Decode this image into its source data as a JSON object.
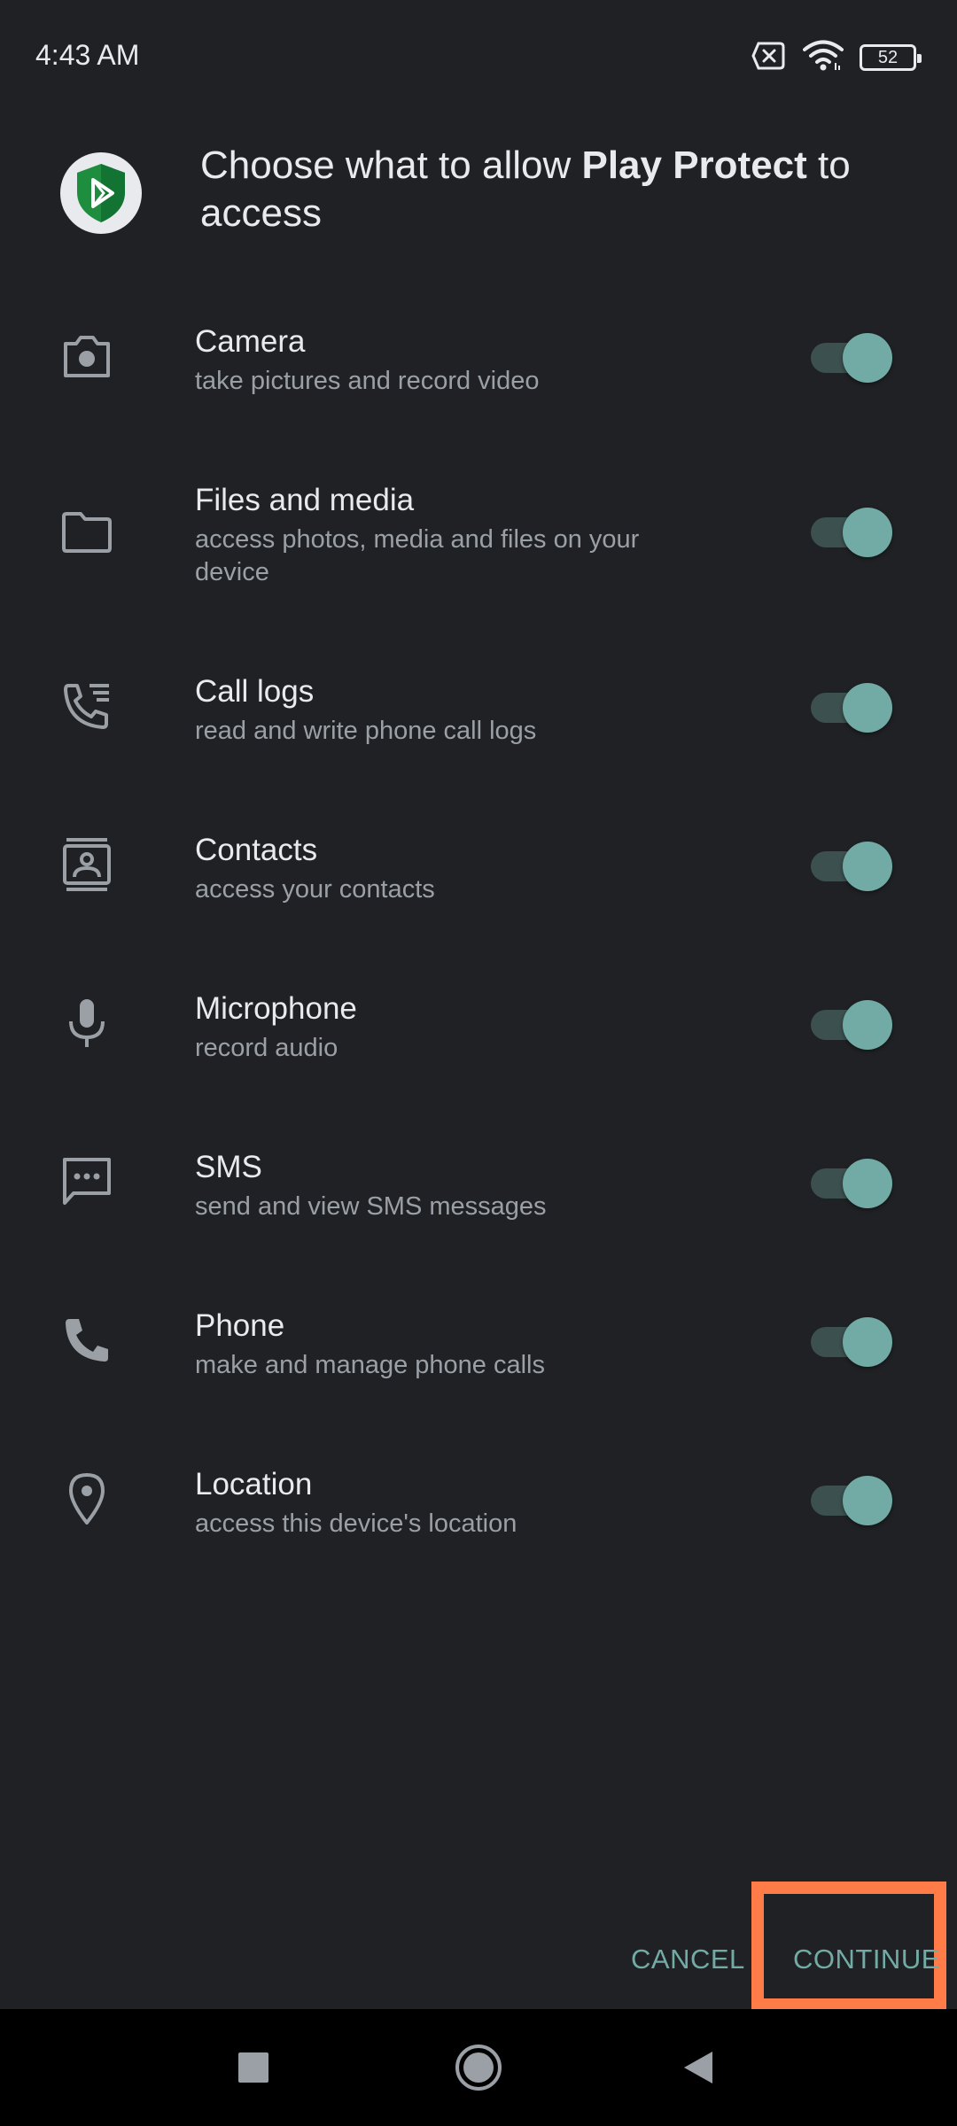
{
  "status_bar": {
    "time": "4:43 AM",
    "battery": "52",
    "icons": [
      "no-sim-icon",
      "wifi-icon",
      "battery-icon"
    ]
  },
  "header": {
    "title_prefix": "Choose what to allow ",
    "app_name": "Play Protect",
    "title_suffix": " to access",
    "app_icon": "play-protect-shield-icon"
  },
  "permissions": [
    {
      "icon": "camera-icon",
      "title": "Camera",
      "description": "take pictures and record video",
      "enabled": true
    },
    {
      "icon": "folder-icon",
      "title": "Files and media",
      "description": "access photos, media and files on your device",
      "enabled": true
    },
    {
      "icon": "call-log-icon",
      "title": "Call logs",
      "description": "read and write phone call logs",
      "enabled": true
    },
    {
      "icon": "contacts-icon",
      "title": "Contacts",
      "description": "access your contacts",
      "enabled": true
    },
    {
      "icon": "microphone-icon",
      "title": "Microphone",
      "description": "record audio",
      "enabled": true
    },
    {
      "icon": "sms-icon",
      "title": "SMS",
      "description": "send and view SMS messages",
      "enabled": true
    },
    {
      "icon": "phone-icon",
      "title": "Phone",
      "description": "make and manage phone calls",
      "enabled": true
    },
    {
      "icon": "location-icon",
      "title": "Location",
      "description": "access this device's location",
      "enabled": true
    }
  ],
  "actions": {
    "cancel_label": "CANCEL",
    "continue_label": "CONTINUE"
  },
  "colors": {
    "background": "#1f2124",
    "accent": "#72aba5",
    "toggle_track": "#3b504f",
    "highlight": "#ff7b47",
    "shield_green": "#1e8e3e"
  },
  "nav_bar": {
    "icons": [
      "recents-icon",
      "home-icon",
      "back-icon"
    ]
  }
}
